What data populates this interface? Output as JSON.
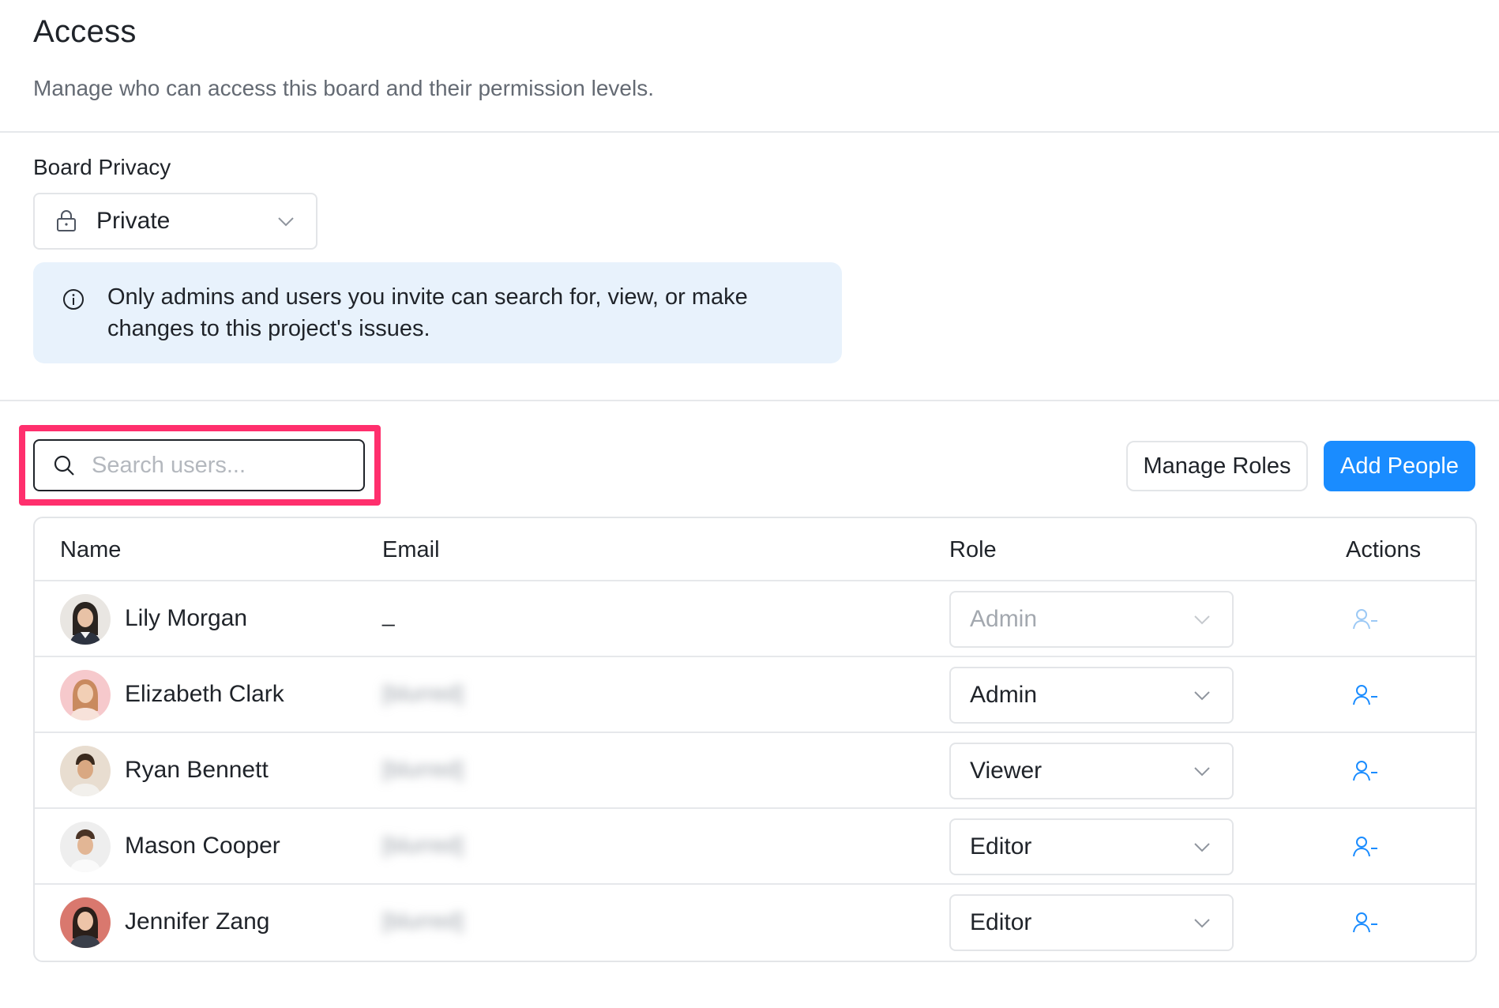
{
  "header": {
    "title": "Access",
    "subtitle": "Manage who can access this board and their permission levels."
  },
  "privacy": {
    "label": "Board Privacy",
    "value": "Private",
    "icon": "lock-icon"
  },
  "info": {
    "text": "Only admins and users you invite can search for, view, or make changes to this project's issues.",
    "icon": "info-icon"
  },
  "search": {
    "placeholder": "Search users...",
    "value": ""
  },
  "buttons": {
    "manage_roles": "Manage Roles",
    "add_people": "Add People"
  },
  "table": {
    "columns": {
      "name": "Name",
      "email": "Email",
      "role": "Role",
      "actions": "Actions"
    },
    "rows": [
      {
        "name": "Lily Morgan",
        "email": "_",
        "role": "Admin",
        "role_disabled": true
      },
      {
        "name": "Elizabeth Clark",
        "email": "[blurred]",
        "role": "Admin",
        "role_disabled": false
      },
      {
        "name": "Ryan Bennett",
        "email": "[blurred]",
        "role": "Viewer",
        "role_disabled": false
      },
      {
        "name": "Mason Cooper",
        "email": "[blurred]",
        "role": "Editor",
        "role_disabled": false
      },
      {
        "name": "Jennifer Zang",
        "email": "[blurred]",
        "role": "Editor",
        "role_disabled": false
      }
    ]
  },
  "colors": {
    "primary": "#1a8cff",
    "highlight": "#ff2f6d",
    "info_bg": "#e8f2fc",
    "action_icon": "#1a8cff"
  }
}
